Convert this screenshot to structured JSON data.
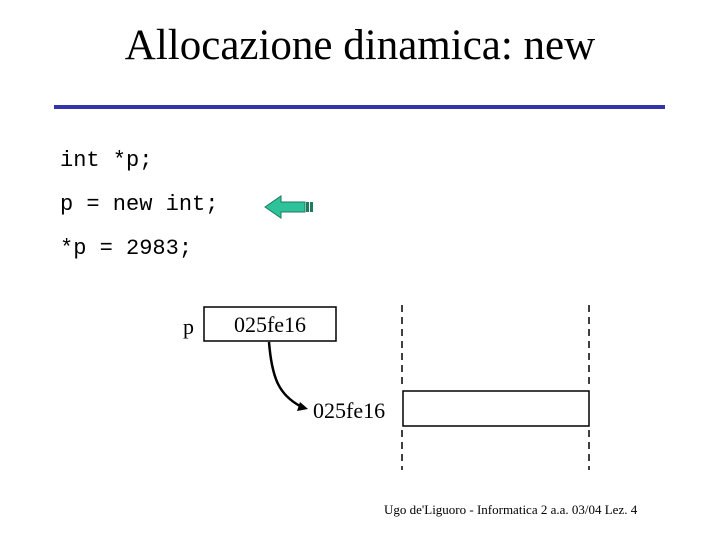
{
  "slide": {
    "title": "Allocazione dinamica: new",
    "accent_color": "#3333aa",
    "arrow_color": "#2ec29a"
  },
  "code": {
    "lines": [
      "int *p;",
      "p = new int;",
      "*p = 2983;"
    ],
    "highlighted_line_index": 1,
    "pointer_icon": "left-arrow-icon"
  },
  "diagram": {
    "variable_label": "p",
    "variable_value": "025fe16",
    "heap_address_label": "025fe16",
    "heap_cell_value": ""
  },
  "footer": {
    "text": "Ugo de'Liguoro - Informatica 2 a.a. 03/04 Lez. 4"
  }
}
